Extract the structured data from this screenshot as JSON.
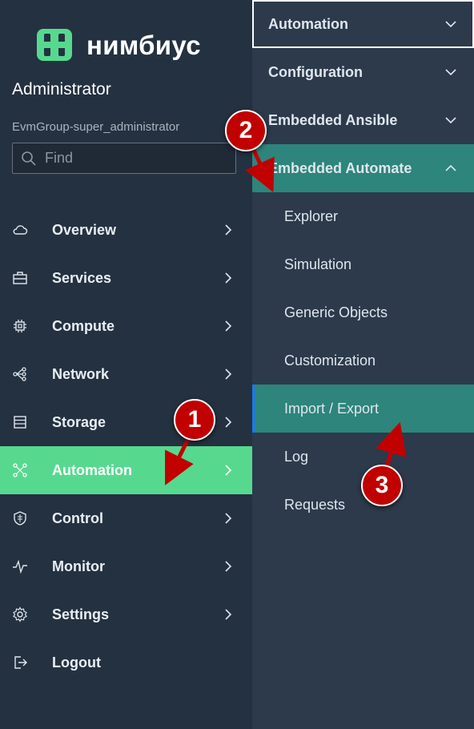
{
  "brand": {
    "logo_text": "нимбиус",
    "accent": "#56d98f"
  },
  "user": {
    "name": "Administrator",
    "group": "EvmGroup-super_administrator"
  },
  "search": {
    "placeholder": "Find",
    "icon": "search-icon"
  },
  "nav": {
    "items": [
      {
        "label": "Overview",
        "icon": "cloud-icon"
      },
      {
        "label": "Services",
        "icon": "toolbox-icon"
      },
      {
        "label": "Compute",
        "icon": "chip-icon"
      },
      {
        "label": "Network",
        "icon": "network-icon"
      },
      {
        "label": "Storage",
        "icon": "database-icon"
      },
      {
        "label": "Automation",
        "icon": "automation-icon",
        "active": true
      },
      {
        "label": "Control",
        "icon": "shield-icon"
      },
      {
        "label": "Monitor",
        "icon": "pulse-icon"
      },
      {
        "label": "Settings",
        "icon": "gear-icon"
      },
      {
        "label": "Logout",
        "icon": "logout-icon"
      }
    ]
  },
  "submenu": {
    "header": "Automation",
    "groups": [
      {
        "label": "Configuration"
      },
      {
        "label": "Embedded Ansible"
      },
      {
        "label": "Embedded Automate",
        "expanded": true
      }
    ],
    "leaves": [
      {
        "label": "Explorer"
      },
      {
        "label": "Simulation"
      },
      {
        "label": "Generic Objects"
      },
      {
        "label": "Customization"
      },
      {
        "label": "Import / Export",
        "active": true
      },
      {
        "label": "Log"
      },
      {
        "label": "Requests"
      }
    ]
  },
  "annotations": {
    "step1": "1",
    "step2": "2",
    "step3": "3",
    "color": "#c10000"
  }
}
